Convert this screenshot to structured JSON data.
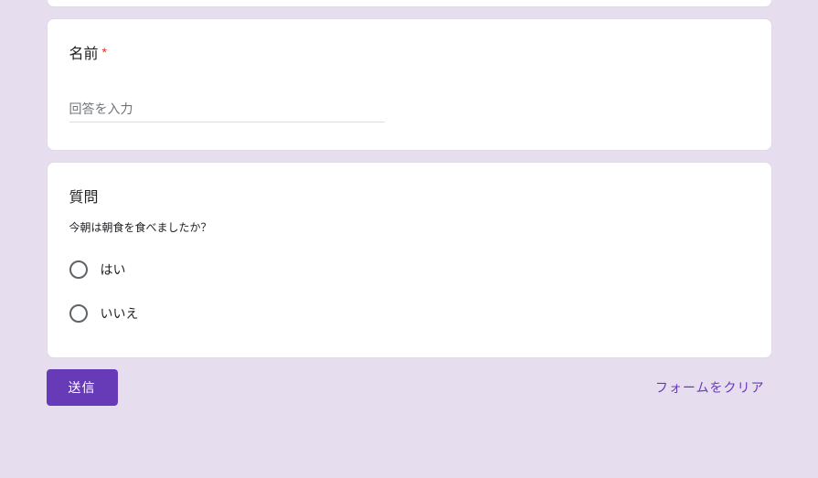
{
  "card1": {
    "title": "名前",
    "required_mark": "*",
    "placeholder": "回答を入力"
  },
  "card2": {
    "title": "質問",
    "subtitle": "今朝は朝食を食べましたか？",
    "options": [
      "はい",
      "いいえ"
    ]
  },
  "footer": {
    "submit": "送信",
    "clear": "フォームをクリア"
  }
}
